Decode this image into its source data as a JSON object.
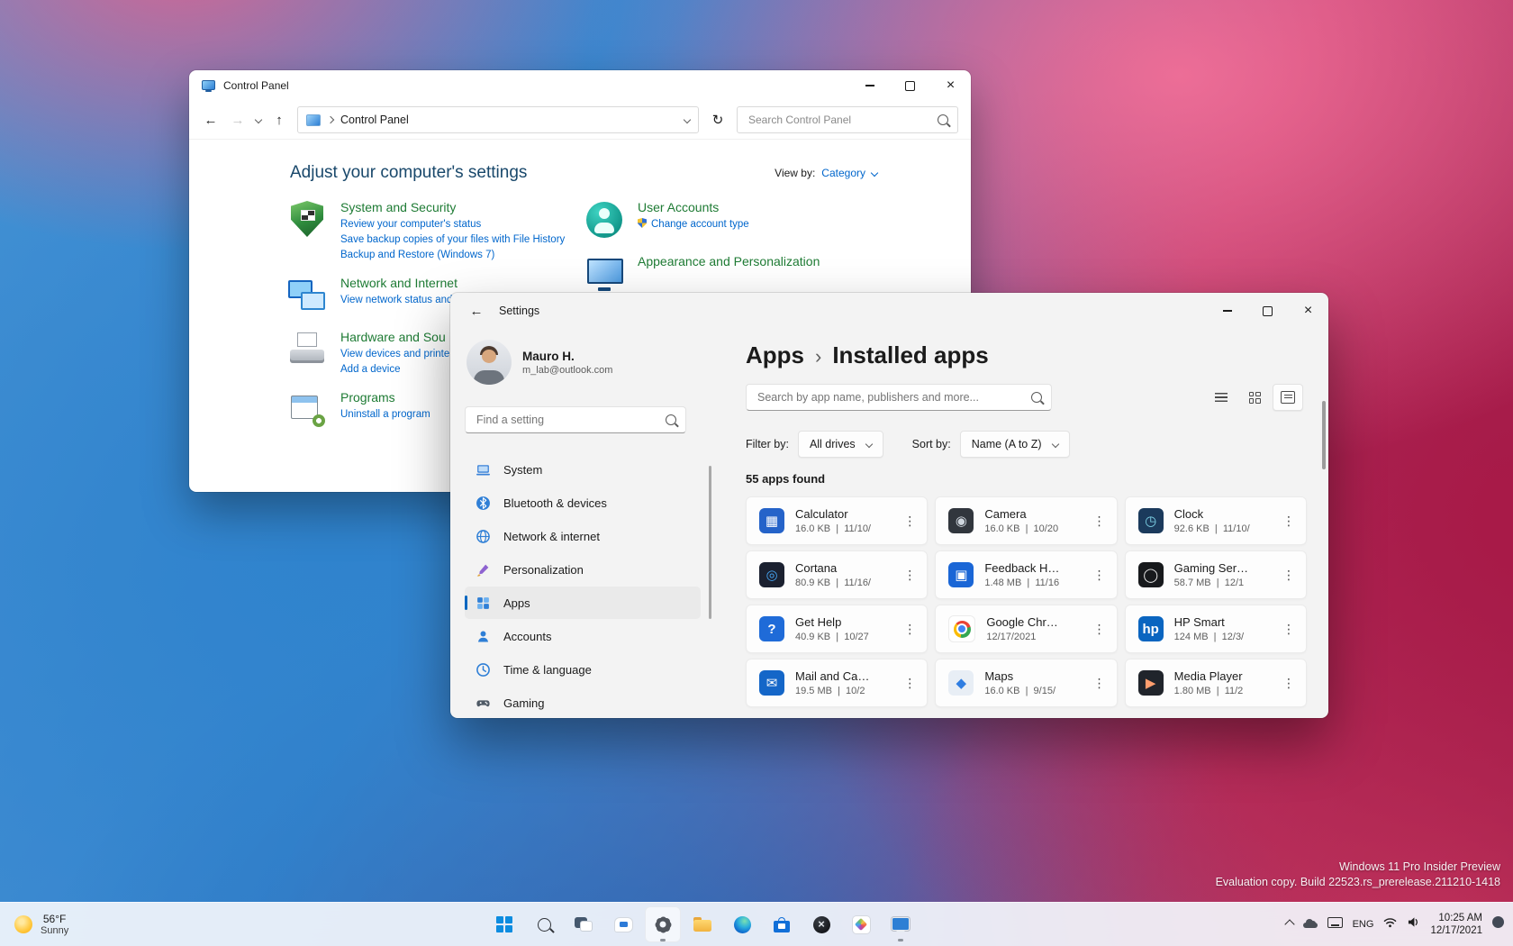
{
  "colors": {
    "accent": "#0067c0",
    "link_blue": "#0066cc",
    "cp_category_green": "#1e7b34",
    "cp_heading": "#19486b"
  },
  "watermark": {
    "line1": "Windows 11 Pro Insider Preview",
    "line2": "Evaluation copy. Build 22523.rs_prerelease.211210-1418"
  },
  "control_panel": {
    "window_title": "Control Panel",
    "address": "Control Panel",
    "search_placeholder": "Search Control Panel",
    "heading": "Adjust your computer's settings",
    "view_by": {
      "label": "View by:",
      "value": "Category"
    },
    "left_column": [
      {
        "icon": "shield",
        "title": "System and Security",
        "links": [
          {
            "text": "Review your computer's status"
          },
          {
            "text": "Save backup copies of your files with File History"
          },
          {
            "text": "Backup and Restore (Windows 7)"
          }
        ]
      },
      {
        "icon": "network",
        "title": "Network and Internet",
        "links": [
          {
            "text": "View network status and"
          }
        ]
      },
      {
        "icon": "hardware",
        "title": "Hardware and Sou",
        "links": [
          {
            "text": "View devices and printe"
          },
          {
            "text": "Add a device"
          }
        ]
      },
      {
        "icon": "programs",
        "title": "Programs",
        "links": [
          {
            "text": "Uninstall a program"
          }
        ]
      }
    ],
    "right_column": [
      {
        "icon": "user",
        "title": "User Accounts",
        "links": [
          {
            "text": "Change account type",
            "uac": true
          }
        ]
      },
      {
        "icon": "appearance",
        "title": "Appearance and Personalization",
        "links": []
      }
    ]
  },
  "settings": {
    "window_title": "Settings",
    "user": {
      "name": "Mauro H.",
      "email": "m_lab@outlook.com"
    },
    "find_placeholder": "Find a setting",
    "nav": [
      {
        "icon": "system",
        "label": "System",
        "selected": false
      },
      {
        "icon": "bluetooth",
        "label": "Bluetooth & devices",
        "selected": false
      },
      {
        "icon": "network",
        "label": "Network & internet",
        "selected": false
      },
      {
        "icon": "personalization",
        "label": "Personalization",
        "selected": false
      },
      {
        "icon": "apps",
        "label": "Apps",
        "selected": true
      },
      {
        "icon": "accounts",
        "label": "Accounts",
        "selected": false
      },
      {
        "icon": "time",
        "label": "Time & language",
        "selected": false
      },
      {
        "icon": "gaming",
        "label": "Gaming",
        "selected": false
      }
    ],
    "breadcrumb": {
      "parent": "Apps",
      "separator": "›",
      "current": "Installed apps"
    },
    "search_placeholder": "Search by app name, publishers and more...",
    "filter": {
      "label": "Filter by:",
      "value": "All drives"
    },
    "sort": {
      "label": "Sort by:",
      "value": "Name (A to Z)"
    },
    "result_count": "55 apps found",
    "apps": [
      {
        "name": "Calculator",
        "meta": "16.0 KB  |  11/10/",
        "icon": {
          "kind": "glyph",
          "bg": "#2563c9",
          "glyph": "▦",
          "color": "#ffffff"
        }
      },
      {
        "name": "Camera",
        "meta": "16.0 KB  |  10/20",
        "icon": {
          "kind": "glyph",
          "bg": "#31363d",
          "glyph": "◉",
          "color": "#cfd6de"
        }
      },
      {
        "name": "Clock",
        "meta": "92.6 KB  |  11/10/",
        "icon": {
          "kind": "glyph",
          "bg": "#1b3a5c",
          "glyph": "◷",
          "color": "#7fd4e8"
        }
      },
      {
        "name": "Cortana",
        "meta": "80.9 KB  |  11/16/",
        "icon": {
          "kind": "glyph",
          "bg": "#1b2130",
          "glyph": "◎",
          "color": "#46a6f5"
        }
      },
      {
        "name": "Feedback H…",
        "meta": "1.48 MB  |  11/16",
        "icon": {
          "kind": "glyph",
          "bg": "#1a66d6",
          "glyph": "▣",
          "color": "#ffffff"
        }
      },
      {
        "name": "Gaming Ser…",
        "meta": "58.7 MB  |  12/1",
        "icon": {
          "kind": "glyph",
          "bg": "#17191c",
          "glyph": "◯",
          "color": "#e8e8e8"
        }
      },
      {
        "name": "Get Help",
        "meta": "40.9 KB  |  10/27",
        "icon": {
          "kind": "glyph",
          "bg": "#1f6bd8",
          "glyph": "?",
          "color": "#ffffff"
        }
      },
      {
        "name": "Google Chr…",
        "meta": "12/17/2021",
        "icon": {
          "kind": "chrome"
        }
      },
      {
        "name": "HP Smart",
        "meta": "124 MB  |  12/3/",
        "icon": {
          "kind": "glyph",
          "bg": "#0a65c0",
          "glyph": "hp",
          "color": "#ffffff"
        }
      },
      {
        "name": "Mail and Ca…",
        "meta": "19.5 MB  |  10/2",
        "icon": {
          "kind": "glyph",
          "bg": "#1466c8",
          "glyph": "✉",
          "color": "#ffffff"
        }
      },
      {
        "name": "Maps",
        "meta": "16.0 KB  |  9/15/",
        "icon": {
          "kind": "glyph",
          "bg": "#e8eef5",
          "glyph": "◆",
          "color": "#2f7de1"
        }
      },
      {
        "name": "Media Player",
        "meta": "1.80 MB  |  11/2",
        "icon": {
          "kind": "glyph",
          "bg": "#20242b",
          "glyph": "▶",
          "color": "#ff9e6e"
        }
      }
    ]
  },
  "taskbar": {
    "weather": {
      "temp": "56°F",
      "condition": "Sunny"
    },
    "icons": [
      {
        "name": "start"
      },
      {
        "name": "search"
      },
      {
        "name": "task-view"
      },
      {
        "name": "chat"
      },
      {
        "name": "settings",
        "active": true,
        "focused": true
      },
      {
        "name": "file-explorer"
      },
      {
        "name": "edge"
      },
      {
        "name": "store"
      },
      {
        "name": "xbox"
      },
      {
        "name": "photos"
      },
      {
        "name": "control-panel",
        "active": true
      }
    ],
    "tray": {
      "language": "ENG",
      "time": "10:25 AM",
      "date": "12/17/2021"
    }
  }
}
